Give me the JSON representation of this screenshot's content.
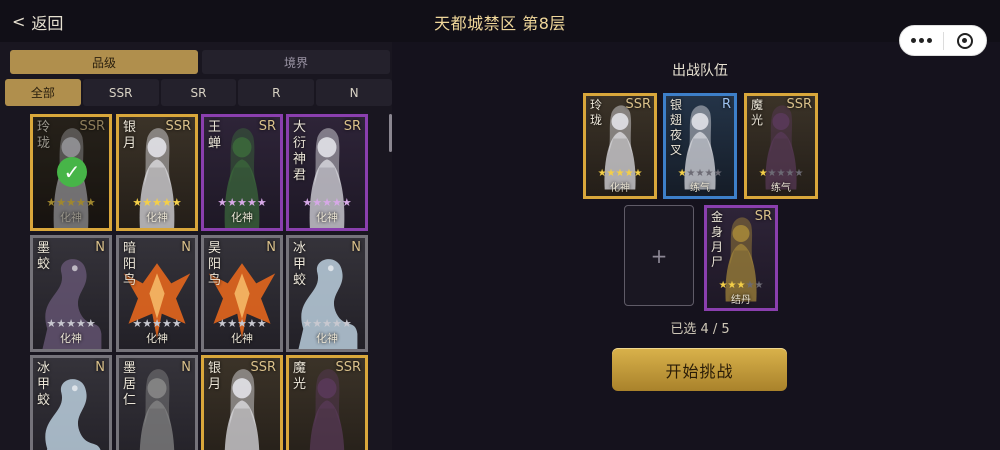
{
  "header": {
    "back_label": "返回",
    "back_chevron": "<",
    "title": "天都城禁区 第8层"
  },
  "filters": {
    "primary_tabs": [
      {
        "label": "品级",
        "active": true
      },
      {
        "label": "境界",
        "active": false
      }
    ],
    "rarity_tabs": [
      {
        "label": "全部",
        "active": true
      },
      {
        "label": "SSR",
        "active": false
      },
      {
        "label": "SR",
        "active": false
      },
      {
        "label": "R",
        "active": false
      },
      {
        "label": "N",
        "active": false
      }
    ]
  },
  "roster": [
    {
      "name": "玲珑",
      "rarity": "SSR",
      "stars": 5,
      "star_color": "gold",
      "stage": "化神",
      "selected": true
    },
    {
      "name": "银月",
      "rarity": "SSR",
      "stars": 5,
      "star_color": "gold",
      "stage": "化神",
      "selected": true
    },
    {
      "name": "王蝉",
      "rarity": "SR",
      "stars": 5,
      "star_color": "pink",
      "stage": "化神",
      "selected": false
    },
    {
      "name": "大衍神君",
      "rarity": "SR",
      "stars": 5,
      "star_color": "pink",
      "stage": "化神",
      "selected": false
    },
    {
      "name": "墨蛟",
      "rarity": "N",
      "stars": 5,
      "star_color": "grey",
      "stage": "化神",
      "selected": false
    },
    {
      "name": "暗阳鸟",
      "rarity": "N",
      "stars": 5,
      "star_color": "grey",
      "stage": "化神",
      "selected": false
    },
    {
      "name": "昊阳鸟",
      "rarity": "N",
      "stars": 5,
      "star_color": "grey",
      "stage": "化神",
      "selected": false
    },
    {
      "name": "冰甲蛟",
      "rarity": "N",
      "stars": 5,
      "star_color": "grey",
      "stage": "化神",
      "selected": false
    },
    {
      "name": "冰甲蛟",
      "rarity": "N",
      "stars": 0,
      "star_color": "grey",
      "stage": "",
      "selected": false
    },
    {
      "name": "墨居仁",
      "rarity": "N",
      "stars": 0,
      "star_color": "grey",
      "stage": "",
      "selected": false
    },
    {
      "name": "银月",
      "rarity": "SSR",
      "stars": 0,
      "star_color": "gold",
      "stage": "",
      "selected": false
    },
    {
      "name": "魔光",
      "rarity": "SSR",
      "stars": 0,
      "star_color": "gold",
      "stage": "",
      "selected": false
    }
  ],
  "team": {
    "title": "出战队伍",
    "slots": [
      {
        "name": "玲珑",
        "rarity": "SSR",
        "stars": 5,
        "star_color": "gold",
        "stage": "化神"
      },
      {
        "name": "银翅夜叉",
        "rarity": "R",
        "stars": 1,
        "star_color": "gold",
        "stage": "练气"
      },
      {
        "name": "魔光",
        "rarity": "SSR",
        "stars": 1,
        "star_color": "gold",
        "stage": "练气"
      },
      {
        "name": "",
        "rarity": "",
        "empty": true,
        "plus": "+"
      },
      {
        "name": "金身月尸",
        "rarity": "SR",
        "stars": 3,
        "star_color": "gold",
        "stage": "结丹"
      }
    ],
    "selected_count": "已选 4 / 5",
    "start_label": "开始挑战"
  },
  "colors": {
    "ssr_border": "#d9a73b",
    "sr_border": "#8a3fae",
    "r_border": "#3d7fc9",
    "n_border": "#75737a",
    "accent_gold": "#b08f4d",
    "button_gold": "#d9b24b",
    "check_green": "#47b548"
  },
  "icons": {
    "more": "more-dots-icon",
    "close": "target-icon",
    "check": "check-icon"
  }
}
